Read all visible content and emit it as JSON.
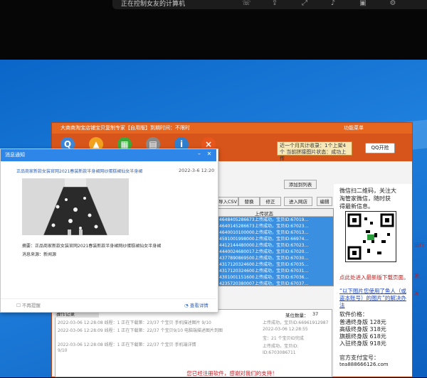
{
  "remote": {
    "title": "正在控制女友的计算机"
  },
  "app": {
    "title": "大商商淘宝店铺宝贝复制专家【自用版】到期时间：不限时",
    "menu_label": "功能菜单",
    "notice": "近一个月共计收录：1个上架4个\n当前拼接图片状态：成功上传",
    "qq_label": "QQ开抢",
    "buttons": [
      "导入CSV",
      "替换",
      "修正",
      "添加到列表",
      "进入网店",
      "编辑"
    ],
    "column_headers": [
      "",
      "上传状态"
    ],
    "grid_rows": [
      {
        "id": "4648405286673",
        "status": "上传成功，宝贝ID:67019..."
      },
      {
        "id": "4640145286673",
        "status": "上传成功，宝贝ID:67023..."
      },
      {
        "id": "4640010100000",
        "status": "上传成功，宝贝ID:67013..."
      },
      {
        "id": "4591001998000",
        "status": "上传成功，宝贝ID:66974..."
      },
      {
        "id": "4412144480000",
        "status": "上传成功，宝贝ID:67023..."
      },
      {
        "id": "4440024680017",
        "status": "上传成功，宝贝ID:67020..."
      },
      {
        "id": "4377890869500",
        "status": "上传成功，宝贝ID:67030..."
      },
      {
        "id": "4317120324600",
        "status": "上传成功，宝贝ID:67035..."
      },
      {
        "id": "4317120324600",
        "status": "上传成功，宝贝ID:67031..."
      },
      {
        "id": "4301001151600",
        "status": "上传成功，宝贝ID:67036..."
      },
      {
        "id": "4235720380007",
        "status": "上传成功，宝贝ID:67037..."
      },
      {
        "id": "4193786370003",
        "status": "上传成功，宝贝ID:67036..."
      }
    ],
    "plain_rows": [
      "39770720181",
      "3154191077",
      "1212001122"
    ],
    "log_tab": "操作记录",
    "count_label": "某位数量：",
    "count_value": "37",
    "log_lines": [
      "2022-03-06 12:28:08  线程：1  正在下载第：23/37 个宝贝 手机描述图片 9/10",
      "2022-03-06 12:28:09  线程：1  正在下载第：22/37 个宝贝9/10 电脑端描述图片到图",
      "2022-03-06 12:28:08  线程：1  正在下载第：22/37 个宝贝 手机端详情",
      "9/10"
    ],
    "upload_lines": [
      "上传成功，宝贝ID:66961912987",
      "2022-03-06 12:28:55",
      "宝：21 个宝贝ID完成",
      "上传成功，宝贝ID:",
      "ID:6703086711"
    ],
    "side_lines": [
      "微信扫二维码，关注大",
      "淘管家微信，随时获",
      "得最新信息。"
    ],
    "side_red": "点此处进入最新版下载页面。",
    "side_blue": "“以下图片您使用了鱼人（或盗本账号）的图片”的解决办法",
    "price_header": "软件价格：",
    "prices": [
      "普通终身版 128元",
      "高级终身版 318元",
      "旗舰终身版 618元",
      "入驻终身版 918元"
    ],
    "pay_label": "官方支付宝号：",
    "pay_account": "tea888666126.com",
    "status_text": "您已经注册软件，感谢对我们的支持！"
  },
  "popup": {
    "title": "消息通知",
    "news_title": "正品商家新款女装官网2021春装新款半身裙网纱蛋糕裙仙女半身裙",
    "date": "2022-3-6 12:20",
    "desc_line": "摘要：正品商家新款女装官网2021春装新款半身裙网纱蛋糕裙仙女半身裙",
    "source_line": "消息来源：新闻源",
    "no_remind": "不再提醒",
    "view_detail": "查看详情"
  },
  "left_strip": [
    "月",
    "文",
    "文",
    "20",
    "21",
    "21",
    "21",
    "21",
    "女",
    "ch"
  ],
  "right_edge": [
    "运行",
    "发",
    "发"
  ],
  "icons": [
    "phone-icon",
    "share-icon",
    "expand-icon",
    "volume-icon",
    "screen-icon",
    "settings-icon"
  ],
  "colors": {
    "accent_orange": "#e6661f",
    "selection_blue": "#3b8fe0",
    "popup_blue": "#2f86e9"
  }
}
